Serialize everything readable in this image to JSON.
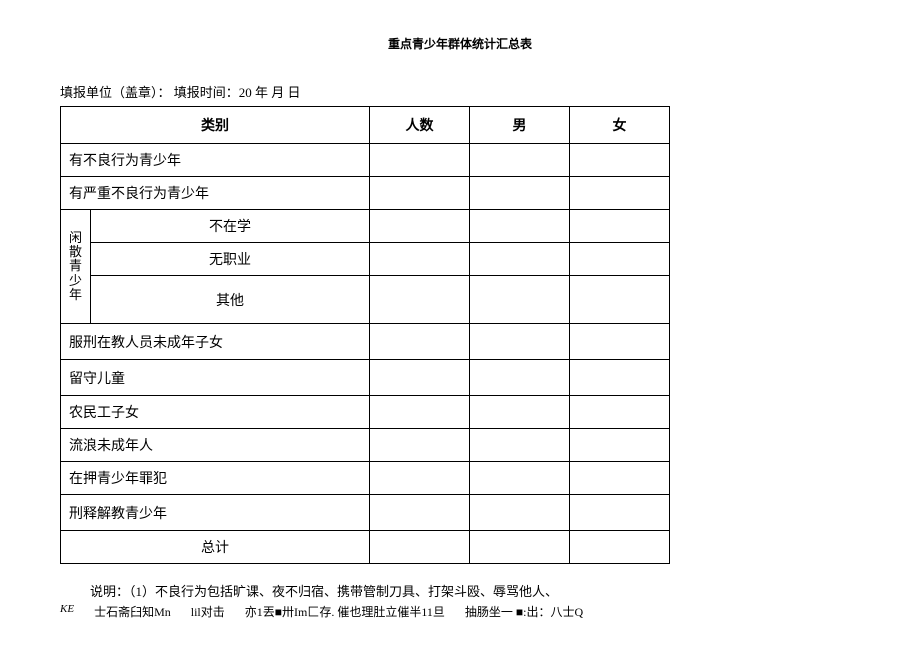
{
  "title": "重点青少年群体统计汇总表",
  "header_line": "填报单位（盖章）： 填报时间：20 年 月 日",
  "table": {
    "headers": {
      "category": "类别",
      "count": "人数",
      "male": "男",
      "female": "女"
    },
    "rows": {
      "r1": "有不良行为青少年",
      "r2": "有严重不良行为青少年",
      "group_label": "闲散青少年",
      "r3a": "不在学",
      "r3b": "无职业",
      "r3c": "其他",
      "r4": "服刑在教人员未成年子女",
      "r5": "留守儿童",
      "r6": "农民工子女",
      "r7": "流浪未成年人",
      "r8": "在押青少年罪犯",
      "r9": "刑释解教青少年",
      "r10": "总计"
    }
  },
  "notes": {
    "line1": "说明：（1）不良行为包括旷课、夜不归宿、携带管制刀具、打架斗殴、辱骂他人、",
    "line2_a": "KE",
    "line2_b": "士石斋臼知Mn",
    "line2_c": "lil对击",
    "line2_d": "亦1丟■卅Im匚存. 催也理肚立催半11旦",
    "line2_e": "抽肠坐一 ■:出：八士Q"
  }
}
